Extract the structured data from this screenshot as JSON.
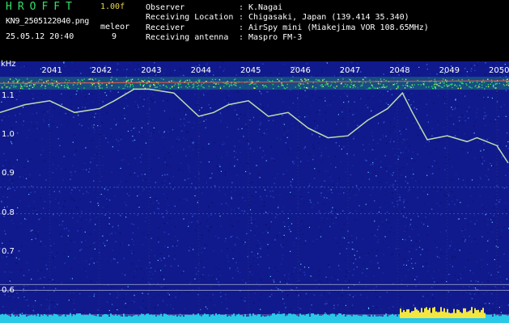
{
  "header": {
    "app_title": "HROFFT",
    "version": "1.00f",
    "filename": "KN9_2505122040.png",
    "datetime": "25.05.12 20:40",
    "mode_label": "meleor",
    "mode_value": "9"
  },
  "station": {
    "observer_label": "Observer",
    "observer": "K.Nagai",
    "location_label": "Receiving Location",
    "location": "Chigasaki, Japan (139.414 35.340)",
    "receiver_label": "Receiver",
    "receiver": "AirSpy mini (Miakejima VOR 108.65MHz)",
    "antenna_label": "Receiving antenna",
    "antenna": "Maspro FM-3",
    "separator": ":"
  },
  "colors": {
    "background": "#000000",
    "noise_base": "#101a8c",
    "trace": "#c8e6b0",
    "band": "#2bd46a",
    "band_core": "#ff5a40",
    "floor": "#29c8e6",
    "floor_peak": "#f4e640"
  },
  "chart_data": {
    "type": "heatmap",
    "y_unit": "kHz",
    "y_ticks": [
      "1.1",
      "1.0",
      "0.9",
      "0.8",
      "0.7",
      "0.6"
    ],
    "y_range": [
      0.6,
      1.15
    ],
    "x_ticks": [
      "2041",
      "2042",
      "2043",
      "2044",
      "2045",
      "2046",
      "2047",
      "2048",
      "2049",
      "2050"
    ],
    "x_range_minutes": [
      2040,
      2050.3
    ],
    "carrier_band_khz": 1.135,
    "doppler_trace": {
      "x": [
        2040.0,
        2040.5,
        2041.0,
        2041.5,
        2042.0,
        2042.3,
        2042.7,
        2043.0,
        2043.5,
        2044.0,
        2044.3,
        2044.6,
        2045.0,
        2045.4,
        2045.8,
        2046.2,
        2046.6,
        2047.0,
        2047.4,
        2047.8,
        2048.1,
        2048.3,
        2048.6,
        2049.0,
        2049.4,
        2049.6,
        2050.0,
        2050.3
      ],
      "y": [
        1.06,
        1.08,
        1.09,
        1.06,
        1.07,
        1.09,
        1.12,
        1.12,
        1.11,
        1.05,
        1.06,
        1.08,
        1.09,
        1.05,
        1.06,
        1.02,
        0.995,
        1.0,
        1.04,
        1.07,
        1.11,
        1.06,
        0.99,
        1.0,
        0.985,
        0.995,
        0.975,
        0.93
      ]
    },
    "horizontal_lines_khz": [
      0.62,
      0.61,
      0.605
    ]
  }
}
